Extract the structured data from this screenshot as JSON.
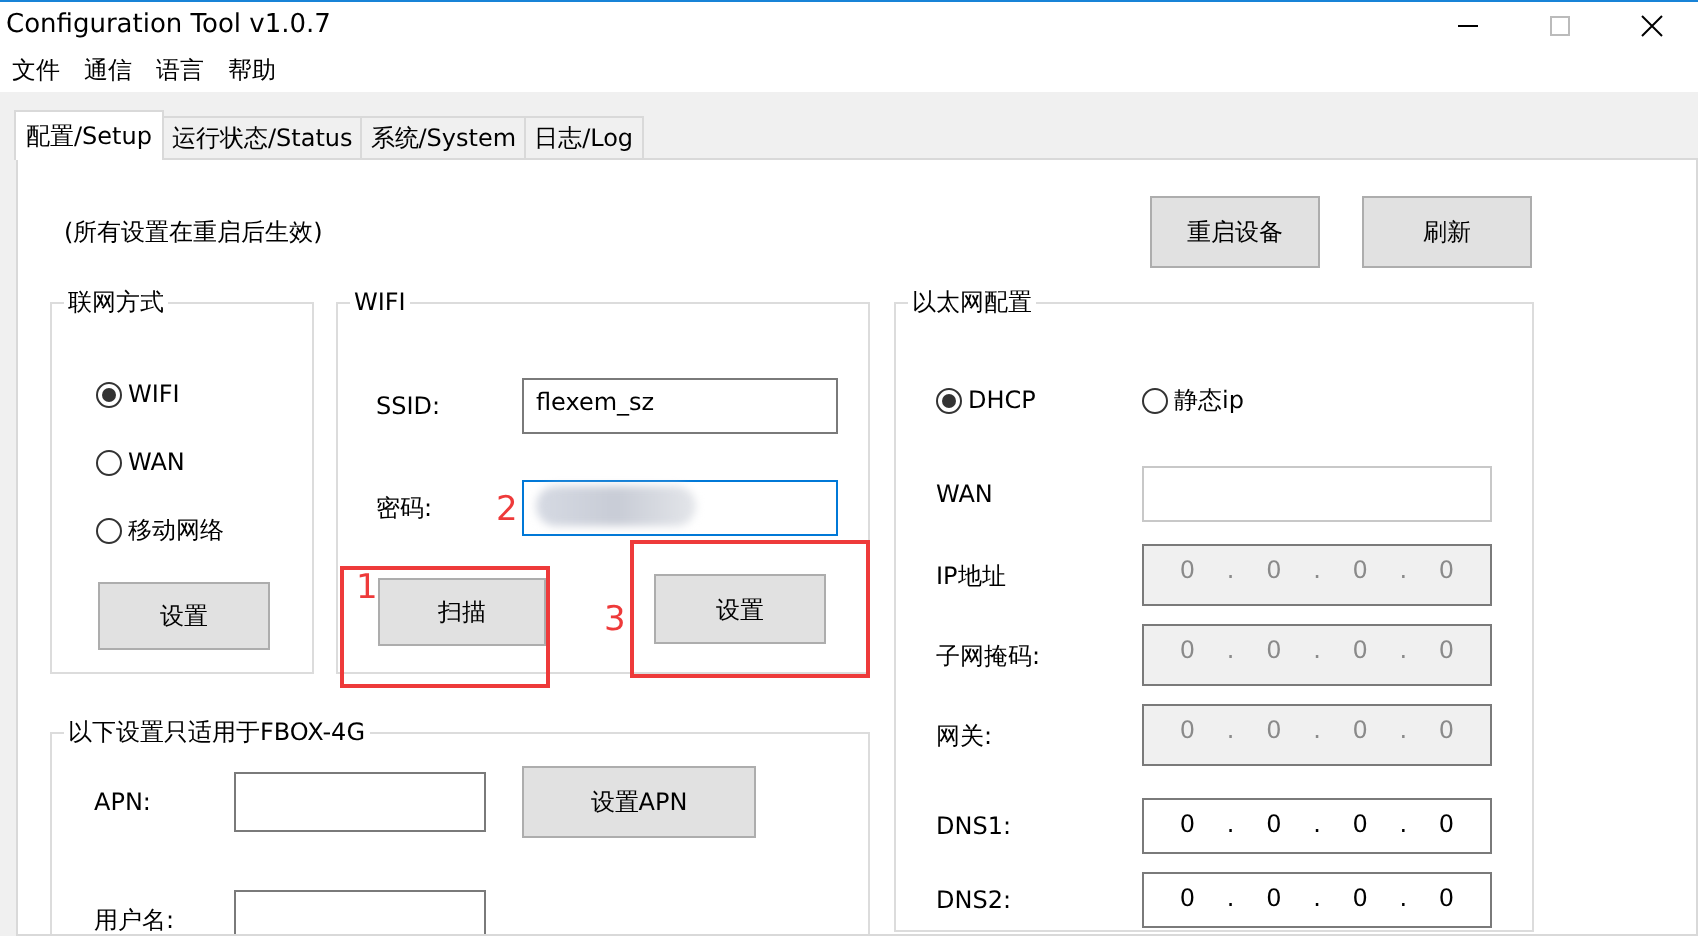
{
  "window": {
    "title": "Configuration Tool v1.0.7"
  },
  "menu": [
    "文件",
    "通信",
    "语言",
    "帮助"
  ],
  "tabs": [
    {
      "label": "配置/Setup",
      "selected": true
    },
    {
      "label": "运行状态/Status",
      "selected": false
    },
    {
      "label": "系统/System",
      "selected": false
    },
    {
      "label": "日志/Log",
      "selected": false
    }
  ],
  "note": "(所有设置在重启后生效)",
  "top_buttons": [
    "重启设备",
    "刷新"
  ],
  "network_mode": {
    "title": "联网方式",
    "options": [
      {
        "label": "WIFI",
        "selected": true
      },
      {
        "label": "WAN",
        "selected": false
      },
      {
        "label": "移动网络",
        "selected": false
      }
    ],
    "button": "设置"
  },
  "wifi": {
    "title": "WIFI",
    "fields": [
      {
        "label": "SSID:",
        "value": "flexem_sz",
        "focused": false,
        "blurred": false
      },
      {
        "label": "密码:",
        "focused": true,
        "blurred": true
      }
    ],
    "scan_button": "扫描",
    "set_button": "设置"
  },
  "ethernet": {
    "title": "以太网配置",
    "modes": [
      {
        "label": "DHCP",
        "selected": true
      },
      {
        "label": "静态ip",
        "selected": false
      }
    ],
    "wan": {
      "label": "WAN"
    },
    "addresses": [
      {
        "label": "IP地址",
        "parts": [
          "0",
          ".",
          "0",
          ".",
          "0",
          ".",
          "0"
        ],
        "disabled": true
      },
      {
        "label": "子网掩码:",
        "parts": [
          "0",
          ".",
          "0",
          ".",
          "0",
          ".",
          "0"
        ],
        "disabled": true
      },
      {
        "label": "网关:",
        "parts": [
          "0",
          ".",
          "0",
          ".",
          "0",
          ".",
          "0"
        ],
        "disabled": true
      },
      {
        "label": "DNS1:",
        "parts": [
          "0",
          ".",
          "0",
          ".",
          "0",
          ".",
          "0"
        ],
        "disabled": false
      },
      {
        "label": "DNS2:",
        "parts": [
          "0",
          ".",
          "0",
          ".",
          "0",
          ".",
          "0"
        ],
        "disabled": false
      }
    ]
  },
  "fbox_4g": {
    "title": "以下设置只适用于FBOX-4G",
    "fields": [
      {
        "label": "APN:"
      },
      {
        "label": "用户名:"
      }
    ],
    "button": "设置APN"
  },
  "annotations": [
    {
      "number": "1"
    },
    {
      "number": "2"
    },
    {
      "number": "3"
    }
  ]
}
